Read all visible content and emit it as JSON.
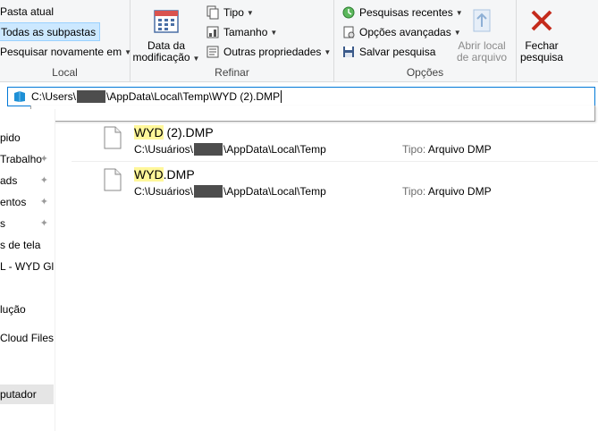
{
  "ribbon": {
    "local": {
      "label": "Local",
      "current_folder": "Pasta atual",
      "all_subfolders": "Todas as subpastas",
      "search_again": "Pesquisar novamente em"
    },
    "refine": {
      "label": "Refinar",
      "date_modified_line1": "Data da",
      "date_modified_line2": "modificação",
      "type": "Tipo",
      "size": "Tamanho",
      "other_props": "Outras propriedades"
    },
    "options": {
      "label": "Opções",
      "recent_searches": "Pesquisas recentes",
      "advanced_options": "Opções avançadas",
      "save_search": "Salvar pesquisa",
      "open_location_line1": "Abrir local",
      "open_location_line2": "de arquivo"
    },
    "close": {
      "line1": "Fechar",
      "line2": "pesquisa"
    }
  },
  "address": {
    "prefix": "C:\\Users\\",
    "suffix": "\\AppData\\Local\\Temp\\WYD (2).DMP"
  },
  "nav": {
    "items": [
      {
        "label": "pido",
        "pinned": false
      },
      {
        "label": "Trabalho",
        "pinned": true
      },
      {
        "label": "ads",
        "pinned": true
      },
      {
        "label": "entos",
        "pinned": true
      },
      {
        "label": "s",
        "pinned": true
      },
      {
        "label": "s de tela",
        "pinned": false
      },
      {
        "label": "L - WYD Glob",
        "pinned": false
      },
      {
        "label": "lução",
        "pinned": false
      },
      {
        "label": "Cloud Files",
        "pinned": false
      },
      {
        "label": "putador",
        "pinned": false
      }
    ],
    "pin_glyph": "📌"
  },
  "results": [
    {
      "name_highlight": "WYD",
      "name_rest": " (2).DMP",
      "path_prefix": "C:\\Usuários\\",
      "path_suffix": "\\AppData\\Local\\Temp",
      "type_label": "Tipo:",
      "type_value": "Arquivo DMP"
    },
    {
      "name_highlight": "WYD",
      "name_rest": ".DMP",
      "path_prefix": "C:\\Usuários\\",
      "path_suffix": "\\AppData\\Local\\Temp",
      "type_label": "Tipo:",
      "type_value": "Arquivo DMP"
    }
  ],
  "colors": {
    "accent": "#0078d7",
    "highlight": "#fff79a",
    "close_red": "#c42b1c"
  }
}
